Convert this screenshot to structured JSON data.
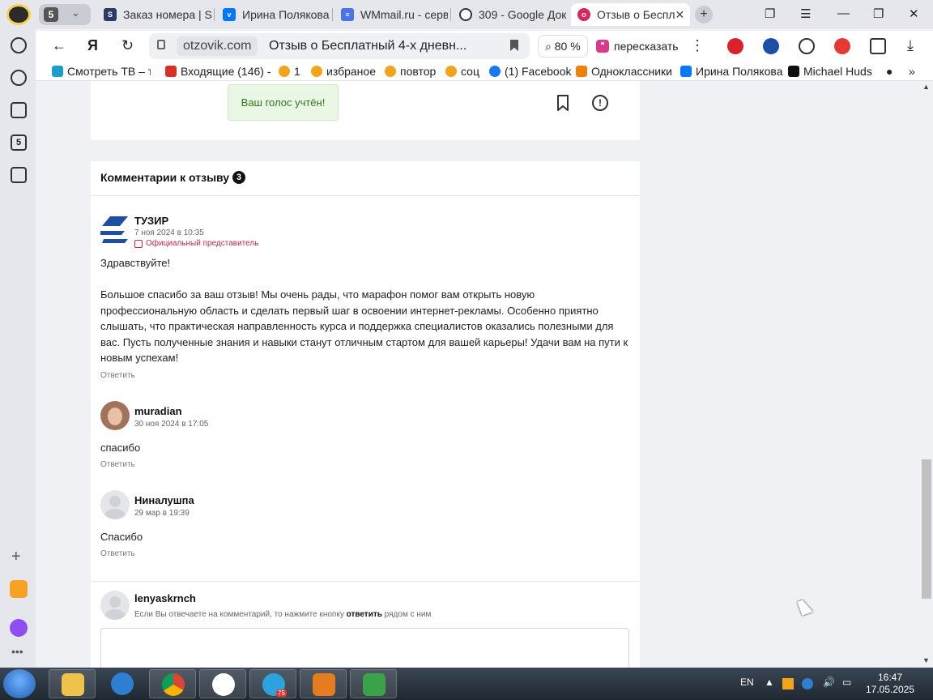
{
  "browser": {
    "tab_group_count": "5",
    "tabs": [
      {
        "title": "Заказ номера | S",
        "favicon": "sms-favicon",
        "color": "#2b3a67"
      },
      {
        "title": "Ирина Полякова",
        "favicon": "vk-favicon",
        "color": "#0077ff"
      },
      {
        "title": "WMmail.ru - серв",
        "favicon": "docs-favicon",
        "color": "#4a73e8"
      },
      {
        "title": "309 - Google Док",
        "favicon": "loading-favicon",
        "color": "#333333"
      },
      {
        "title": "Отзыв о Беспл",
        "favicon": "otzovik-favicon",
        "color": "#d7285d",
        "active": true
      }
    ],
    "address": {
      "domain": "otzovik.com",
      "page_title": "Отзыв о Бесплатный 4-х дневн...",
      "zoom": "80 %",
      "retell_label": "пересказать"
    },
    "bookmarks": [
      {
        "label": "Смотреть ТВ – те",
        "icon": "tv-icon",
        "color": "#1aa0c6"
      },
      {
        "label": "Входящие (146) -",
        "icon": "gmail-icon",
        "color": "#d93025"
      },
      {
        "label": "1",
        "icon": "coin-icon",
        "color": "#f2a51a"
      },
      {
        "label": "избраное",
        "icon": "coin-icon",
        "color": "#f2a51a"
      },
      {
        "label": "повтор",
        "icon": "coin-icon",
        "color": "#f2a51a"
      },
      {
        "label": "соц",
        "icon": "coin-icon",
        "color": "#f2a51a"
      },
      {
        "label": "(1) Facebook",
        "icon": "facebook-icon",
        "color": "#1877f2"
      },
      {
        "label": "Одноклассники",
        "icon": "ok-icon",
        "color": "#ee8208"
      },
      {
        "label": "Ирина Полякова",
        "icon": "vk-icon",
        "color": "#0077ff"
      },
      {
        "label": "Michael Hudso",
        "icon": "x-icon",
        "color": "#111111"
      }
    ]
  },
  "review": {
    "vote_message": "Ваш голос учтён!"
  },
  "comments_section": {
    "title": "Комментарии к отзыву",
    "count": "3",
    "reply_label": "Ответить",
    "comments": [
      {
        "author": "ТУЗИР",
        "date": "7 ноя 2024 в 10:35",
        "role": "Официальный представитель",
        "text": "Здравствуйте!\n\nБольшое спасибо за ваш отзыв! Мы очень рады, что марафон помог вам открыть новую профессиональную область и сделать первый шаг в освоении интернет-рекламы. Особенно приятно слышать, что практическая направленность курса и поддержка специалистов оказались полезными для вас. Пусть полученные знания и навыки станут отличным стартом для вашей карьеры! Удачи вам на пути к новым успехам!"
      },
      {
        "author": "muradian",
        "date": "30 ноя 2024 в 17:05",
        "text": "спасибо"
      },
      {
        "author": "Ниналушпа",
        "date": "29 мар в 19:39",
        "text": "Спасибо"
      }
    ],
    "new_comment": {
      "user": "lenyaskrnch",
      "hint_before": "Если Вы отвечаете на комментарий, то нажмите кнопку ",
      "hint_bold": "ответить",
      "hint_after": " рядом с ним"
    }
  },
  "taskbar": {
    "language": "EN",
    "time": "16:47",
    "date": "17.05.2025",
    "telegram_badge": "75"
  }
}
